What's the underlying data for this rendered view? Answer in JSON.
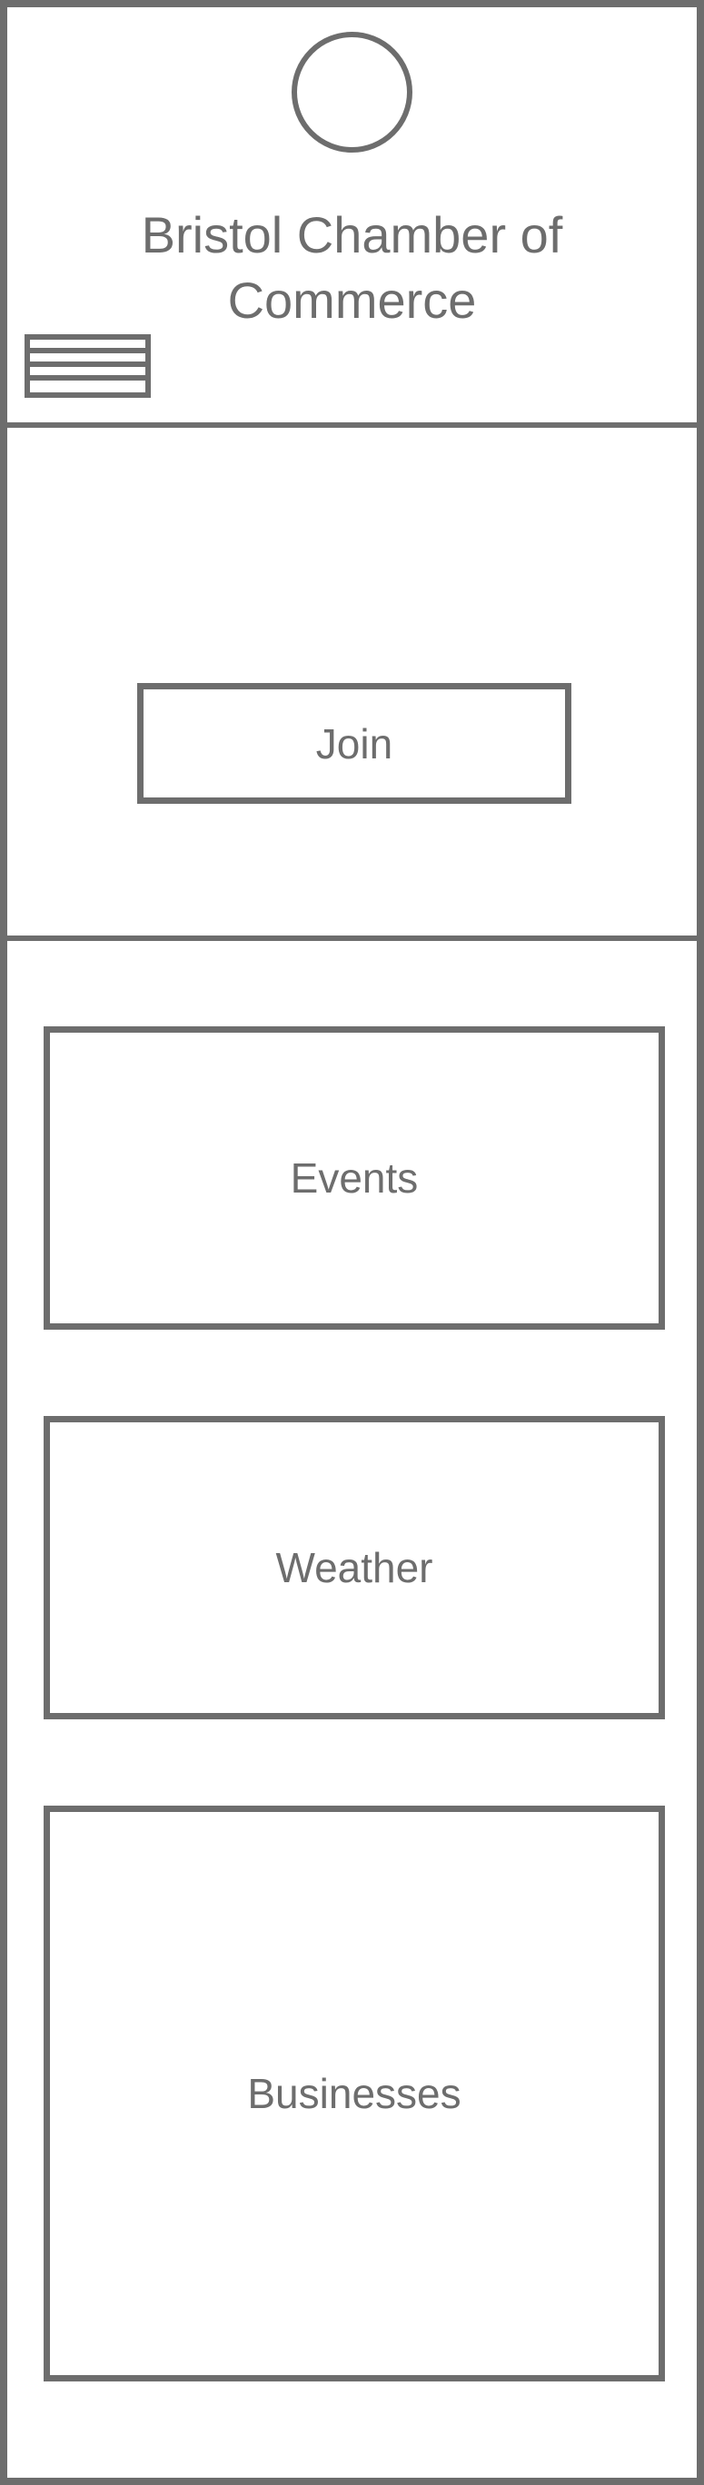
{
  "header": {
    "title": "Bristol Chamber of Commerce",
    "logo_icon": "logo-placeholder-circle",
    "menu_icon": "hamburger-menu-icon"
  },
  "hero": {
    "join_label": "Join"
  },
  "sections": {
    "events_label": "Events",
    "weather_label": "Weather",
    "businesses_label": "Businesses"
  },
  "colors": {
    "wireframe_stroke": "#6d6d6d",
    "background": "#ffffff"
  }
}
